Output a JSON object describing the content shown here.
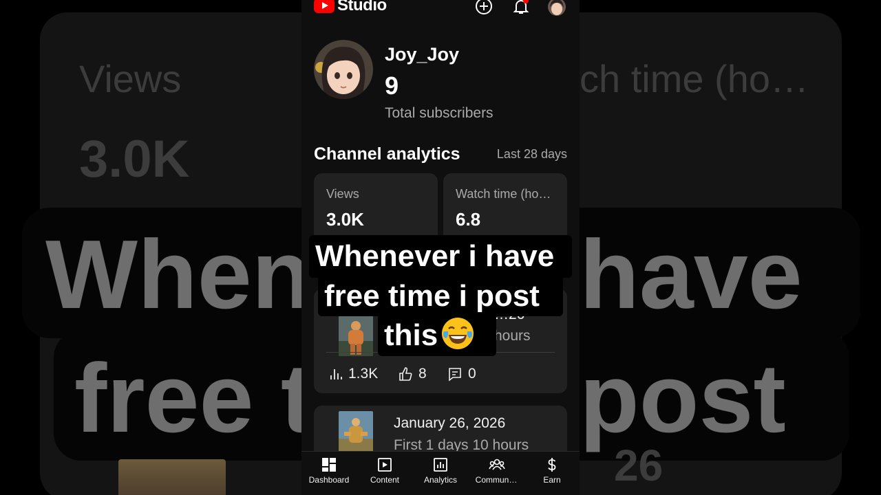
{
  "app": {
    "logo_text": "Studio"
  },
  "channel": {
    "name": "Joy_Joy",
    "subscribers": "9",
    "subscribers_label": "Total subscribers"
  },
  "analytics": {
    "title": "Channel analytics",
    "period": "Last 28 days",
    "metrics": [
      {
        "label": "Views",
        "value": "3.0K"
      },
      {
        "label": "Watch time (ho…",
        "value": "6.8"
      }
    ]
  },
  "videos": [
    {
      "date": "…26",
      "subtitle": "hours",
      "views": "1.3K",
      "likes": "8",
      "comments": "0"
    },
    {
      "date": "January 26, 2026",
      "subtitle": "First 1 days 10 hours"
    }
  ],
  "nav": [
    {
      "label": "Dashboard",
      "icon": "dashboard-icon"
    },
    {
      "label": "Content",
      "icon": "content-icon"
    },
    {
      "label": "Analytics",
      "icon": "analytics-icon"
    },
    {
      "label": "Commun…",
      "icon": "community-icon"
    },
    {
      "label": "Earn",
      "icon": "dollar-icon"
    }
  ],
  "caption": {
    "line1": "Whenever i have",
    "line2": "free time i post",
    "line3": "this",
    "emoji": "laughing-tears-emoji"
  },
  "background": {
    "views_label": "Views",
    "watch_label": "ch time (ho…",
    "views_value": "3.0K",
    "cap_line1_left": "When",
    "cap_line1_right": "have",
    "cap_line2_left": "free t",
    "cap_line2_right": "post",
    "date_fragment": "26"
  },
  "colors": {
    "accent": "#ff0000",
    "background": "#0f0f0f",
    "card": "#212121",
    "notification_dot": "#ff0000"
  }
}
